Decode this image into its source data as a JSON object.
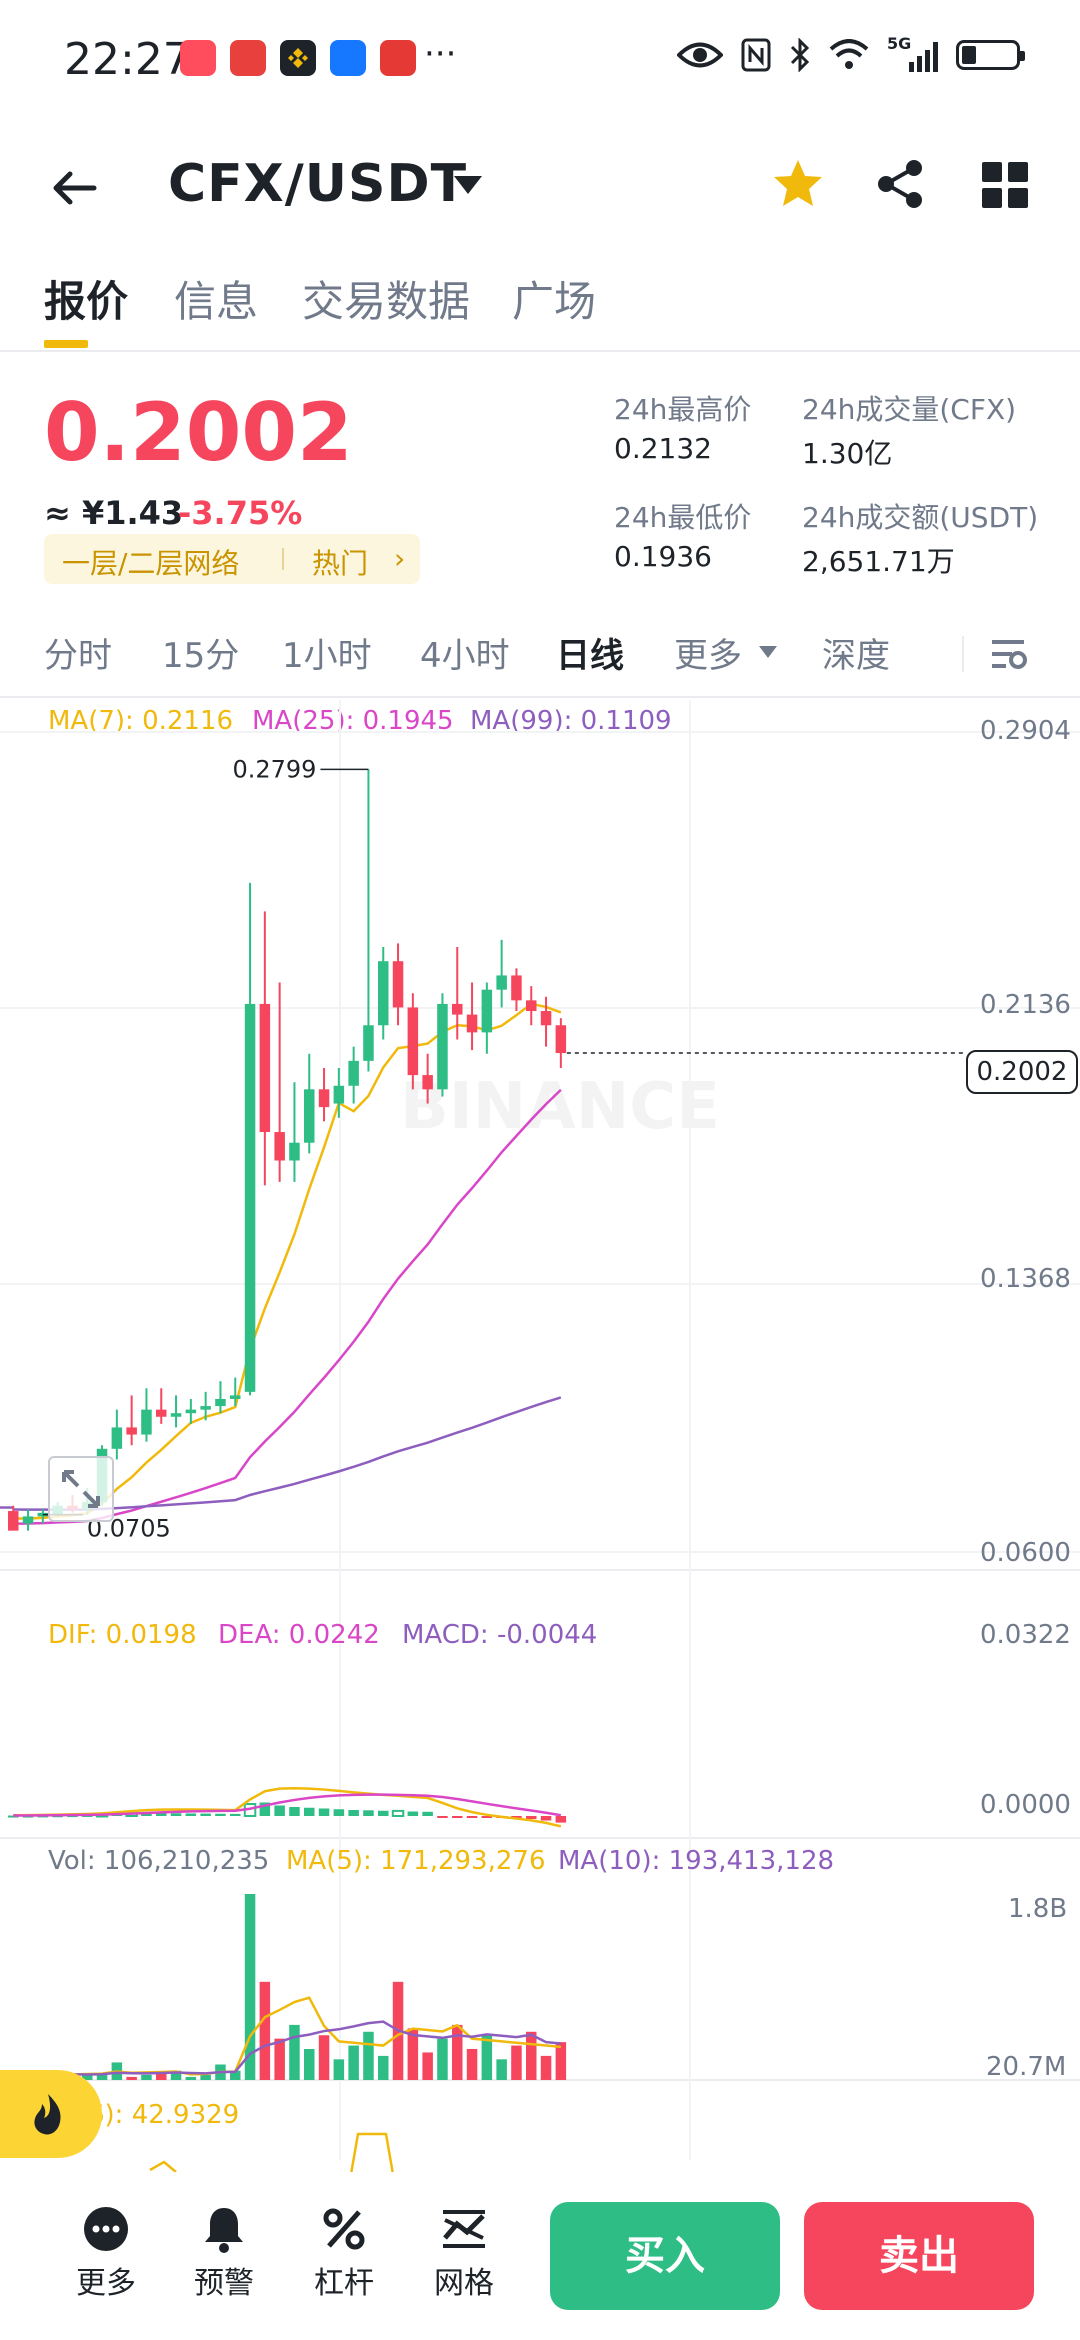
{
  "status_bar": {
    "time": "22:27",
    "overflow": "···",
    "network": "5G",
    "notification_icons": [
      "red-book-icon",
      "game-icon",
      "binance-icon",
      "blue-app-icon",
      "red-app-icon"
    ]
  },
  "header": {
    "pair": "CFX/USDT",
    "favorite_color": "#f0b90b"
  },
  "main_tabs": [
    {
      "label": "报价",
      "active": true
    },
    {
      "label": "信息",
      "active": false
    },
    {
      "label": "交易数据",
      "active": false
    },
    {
      "label": "广场",
      "active": false
    }
  ],
  "price": {
    "last": "0.2002",
    "cny": "≈ ¥1.43",
    "change": "-3.75%",
    "tag": "一层/二层网络",
    "tag_hot": "热门",
    "tag_arrow": "›"
  },
  "stats": {
    "high_label": "24h最高价",
    "high_value": "0.2132",
    "low_label": "24h最低价",
    "low_value": "0.1936",
    "vol_label": "24h成交量(CFX)",
    "vol_value": "1.30亿",
    "amount_label": "24h成交额(USDT)",
    "amount_value": "2,651.71万"
  },
  "intervals": [
    {
      "label": "分时",
      "active": false
    },
    {
      "label": "15分",
      "active": false
    },
    {
      "label": "1小时",
      "active": false
    },
    {
      "label": "4小时",
      "active": false
    },
    {
      "label": "日线",
      "active": true
    },
    {
      "label": "更多",
      "active": false
    },
    {
      "label": "深度",
      "active": false
    }
  ],
  "chart_data": {
    "type": "candlestick",
    "ma_labels": {
      "ma7": "MA(7): 0.2116",
      "ma25": "MA(25): 0.1945",
      "ma99": "MA(99): 0.1109"
    },
    "price_axis": [
      "0.2904",
      "0.2136",
      "0.1368",
      "0.0600"
    ],
    "current_price_tag": "0.2002",
    "high_marker": "0.2799",
    "low_marker": "0.0705",
    "watermark": "BINANCE",
    "candles": [
      {
        "o": 0.0715,
        "h": 0.073,
        "l": 0.066,
        "c": 0.066
      },
      {
        "o": 0.068,
        "h": 0.072,
        "l": 0.066,
        "c": 0.07
      },
      {
        "o": 0.07,
        "h": 0.072,
        "l": 0.068,
        "c": 0.071
      },
      {
        "o": 0.0705,
        "h": 0.074,
        "l": 0.07,
        "c": 0.073
      },
      {
        "o": 0.073,
        "h": 0.076,
        "l": 0.071,
        "c": 0.072
      },
      {
        "o": 0.072,
        "h": 0.078,
        "l": 0.0705,
        "c": 0.074
      },
      {
        "o": 0.074,
        "h": 0.09,
        "l": 0.073,
        "c": 0.089
      },
      {
        "o": 0.089,
        "h": 0.1,
        "l": 0.086,
        "c": 0.095
      },
      {
        "o": 0.095,
        "h": 0.104,
        "l": 0.09,
        "c": 0.093
      },
      {
        "o": 0.093,
        "h": 0.106,
        "l": 0.091,
        "c": 0.1
      },
      {
        "o": 0.1,
        "h": 0.106,
        "l": 0.096,
        "c": 0.098
      },
      {
        "o": 0.098,
        "h": 0.104,
        "l": 0.095,
        "c": 0.099
      },
      {
        "o": 0.099,
        "h": 0.103,
        "l": 0.096,
        "c": 0.1
      },
      {
        "o": 0.1,
        "h": 0.105,
        "l": 0.097,
        "c": 0.101
      },
      {
        "o": 0.101,
        "h": 0.108,
        "l": 0.099,
        "c": 0.103
      },
      {
        "o": 0.103,
        "h": 0.109,
        "l": 0.101,
        "c": 0.104
      },
      {
        "o": 0.105,
        "h": 0.248,
        "l": 0.104,
        "c": 0.214
      },
      {
        "o": 0.214,
        "h": 0.24,
        "l": 0.163,
        "c": 0.178
      },
      {
        "o": 0.178,
        "h": 0.22,
        "l": 0.164,
        "c": 0.17
      },
      {
        "o": 0.17,
        "h": 0.192,
        "l": 0.164,
        "c": 0.175
      },
      {
        "o": 0.175,
        "h": 0.2,
        "l": 0.172,
        "c": 0.19
      },
      {
        "o": 0.19,
        "h": 0.196,
        "l": 0.181,
        "c": 0.185
      },
      {
        "o": 0.186,
        "h": 0.196,
        "l": 0.182,
        "c": 0.191
      },
      {
        "o": 0.191,
        "h": 0.202,
        "l": 0.186,
        "c": 0.198
      },
      {
        "o": 0.198,
        "h": 0.2799,
        "l": 0.195,
        "c": 0.208
      },
      {
        "o": 0.208,
        "h": 0.23,
        "l": 0.204,
        "c": 0.226
      },
      {
        "o": 0.226,
        "h": 0.231,
        "l": 0.208,
        "c": 0.213
      },
      {
        "o": 0.213,
        "h": 0.217,
        "l": 0.19,
        "c": 0.194
      },
      {
        "o": 0.194,
        "h": 0.2,
        "l": 0.186,
        "c": 0.19
      },
      {
        "o": 0.19,
        "h": 0.217,
        "l": 0.188,
        "c": 0.214
      },
      {
        "o": 0.214,
        "h": 0.23,
        "l": 0.204,
        "c": 0.211
      },
      {
        "o": 0.211,
        "h": 0.22,
        "l": 0.201,
        "c": 0.206
      },
      {
        "o": 0.206,
        "h": 0.22,
        "l": 0.2,
        "c": 0.218
      },
      {
        "o": 0.218,
        "h": 0.232,
        "l": 0.213,
        "c": 0.222
      },
      {
        "o": 0.222,
        "h": 0.224,
        "l": 0.212,
        "c": 0.215
      },
      {
        "o": 0.215,
        "h": 0.219,
        "l": 0.208,
        "c": 0.212
      },
      {
        "o": 0.212,
        "h": 0.216,
        "l": 0.202,
        "c": 0.208
      },
      {
        "o": 0.208,
        "h": 0.21,
        "l": 0.196,
        "c": 0.2002
      }
    ],
    "macd": {
      "labels": {
        "dif": "DIF: 0.0198",
        "dea": "DEA: 0.0242",
        "macd": "MACD: -0.0044"
      },
      "axis": [
        "0.0322",
        "0.0000"
      ],
      "hist": [
        0.0003,
        0.0003,
        0.0004,
        0.0005,
        0.0006,
        0.0007,
        0.001,
        0.0015,
        0.0018,
        0.002,
        0.0019,
        0.0018,
        0.0017,
        0.0016,
        0.0015,
        0.0014,
        0.008,
        0.009,
        0.007,
        0.006,
        0.0055,
        0.005,
        0.0045,
        0.004,
        0.0038,
        0.0035,
        0.0034,
        0.003,
        0.0028,
        -0.0005,
        -0.0006,
        -0.0008,
        -0.001,
        -0.0012,
        -0.0015,
        -0.002,
        -0.003,
        -0.0044
      ]
    },
    "volume": {
      "labels": {
        "vol": "Vol: 106,210,235",
        "ma5": "MA(5): 171,293,276",
        "ma10": "MA(10): 193,413,128"
      },
      "axis": [
        "1.8B",
        "20.7M"
      ],
      "rsi_label": "6): 42.9329"
    }
  },
  "floating_button": {
    "icon": "fire-icon",
    "color": "#fcd535"
  },
  "bottom_bar": {
    "items": [
      {
        "label": "更多",
        "icon": "more-icon"
      },
      {
        "label": "预警",
        "icon": "bell-icon"
      },
      {
        "label": "杠杆",
        "icon": "percent-icon"
      },
      {
        "label": "网格",
        "icon": "grid-chart-icon"
      }
    ],
    "buy_label": "买入",
    "sell_label": "卖出",
    "buy_color": "#2ebd85",
    "sell_color": "#f6465d"
  }
}
